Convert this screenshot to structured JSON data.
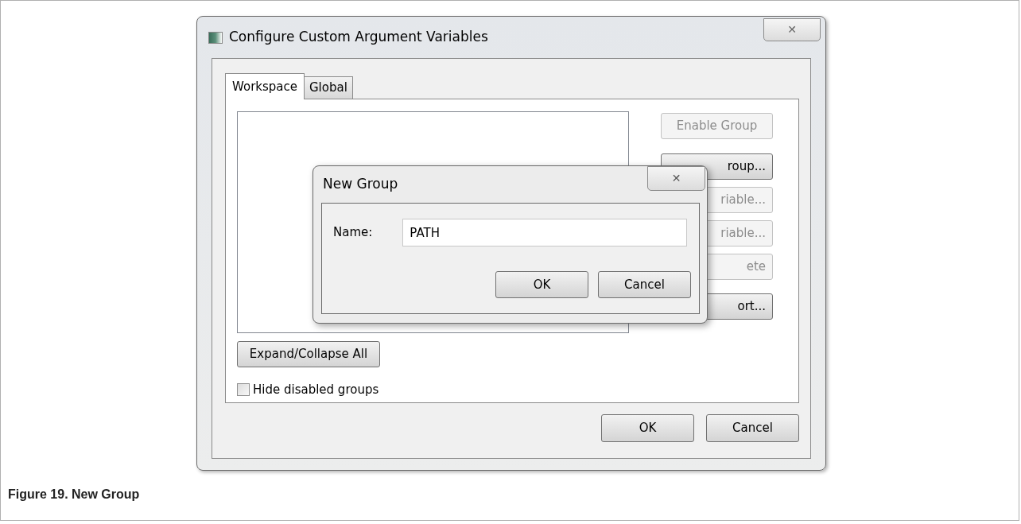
{
  "window": {
    "title": "Configure Custom Argument Variables",
    "close": "✕"
  },
  "tabs": [
    {
      "label": "Workspace",
      "selected": true
    },
    {
      "label": "Global",
      "selected": false
    }
  ],
  "right_buttons": [
    {
      "label": "Enable Group",
      "disabled": true,
      "covered": false
    },
    {
      "label": "roup...",
      "disabled": false,
      "covered": true
    },
    {
      "label": "riable...",
      "disabled": true,
      "covered": true
    },
    {
      "label": "riable...",
      "disabled": true,
      "covered": true
    },
    {
      "label": "ete",
      "disabled": true,
      "covered": true
    },
    {
      "label": "ort...",
      "disabled": false,
      "covered": true
    }
  ],
  "expand_button": "Expand/Collapse All",
  "hide_disabled": {
    "label": "Hide disabled groups",
    "checked": false
  },
  "footer_buttons": [
    "OK",
    "Cancel"
  ],
  "dialog": {
    "title": "New Group",
    "close": "✕",
    "name_label": "Name:",
    "name_value": "PATH",
    "buttons": [
      "OK",
      "Cancel"
    ]
  },
  "caption": "Figure 19. New Group"
}
